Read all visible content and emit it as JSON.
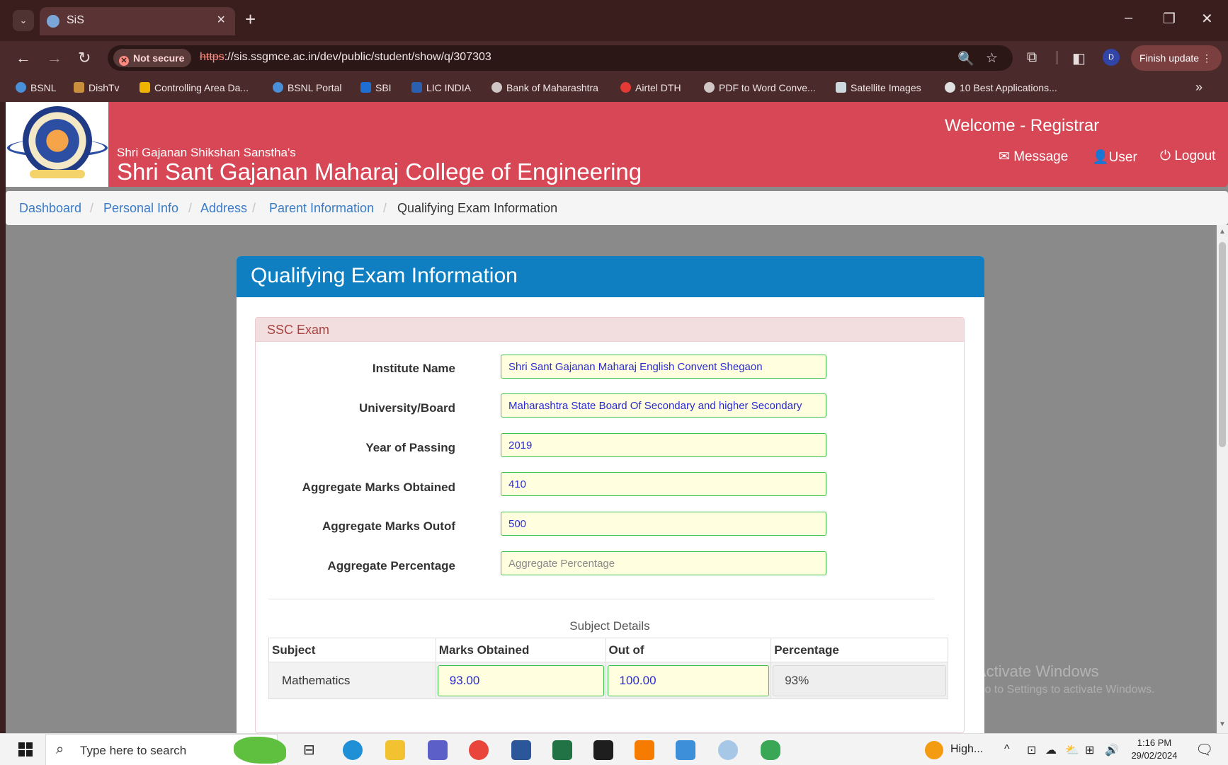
{
  "browser": {
    "tab_title": "SiS",
    "tab_close": "×",
    "new_tab": "+",
    "not_secure": "Not secure",
    "url_proto": "https",
    "url_rest": "://sis.ssgmce.ac.in/dev/public/student/show/q/307303",
    "profile_initial": "D",
    "finish_update": "Finish update ⋮",
    "bookmarks": [
      "BSNL",
      "DishTv",
      "Controlling Area Da...",
      "BSNL Portal",
      "SBI",
      "LIC INDIA",
      "Bank of Maharashtra",
      "Airtel DTH",
      "PDF to Word Conve...",
      "Satellite Images",
      "10 Best Applications..."
    ],
    "bookmarks_more": "»"
  },
  "header": {
    "sanstha": "Shri Gajanan Shikshan Sanstha's",
    "college": "Shri Sant Gajanan Maharaj College of Engineering",
    "welcome": "Welcome - Registrar",
    "links": [
      "Message",
      "User",
      "Logout"
    ]
  },
  "breadcrumb": [
    "Dashboard",
    "Personal Info",
    "Address",
    "Parent Information",
    "Qualifying Exam Information"
  ],
  "card": {
    "title": "Qualifying Exam Information",
    "panel_title": "SSC Exam",
    "fields": [
      {
        "label": "Institute Name",
        "value": "Shri Sant Gajanan Maharaj English Convent Shegaon",
        "placeholder": ""
      },
      {
        "label": "University/Board",
        "value": "Maharashtra State Board Of Secondary and higher Secondary",
        "placeholder": ""
      },
      {
        "label": "Year of Passing",
        "value": "2019",
        "placeholder": ""
      },
      {
        "label": "Aggregate Marks Obtained",
        "value": "410",
        "placeholder": ""
      },
      {
        "label": "Aggregate Marks Outof",
        "value": "500",
        "placeholder": ""
      },
      {
        "label": "Aggregate Percentage",
        "value": "",
        "placeholder": "Aggregate Percentage"
      }
    ],
    "subject_caption": "Subject Details",
    "table": {
      "headers": [
        "Subject",
        "Marks Obtained",
        "Out of",
        "Percentage"
      ],
      "rows": [
        {
          "subject": "Mathematics",
          "marks": "93.00",
          "outof": "100.00",
          "percentage": "93%"
        }
      ]
    }
  },
  "watermark": {
    "line1": "Activate Windows",
    "line2": "Go to Settings to activate Windows."
  },
  "taskbar": {
    "search_placeholder": "Type here to search",
    "weather": "High...",
    "time": "1:16 PM",
    "date": "29/02/2024"
  },
  "colors": {
    "header_red": "#d84756",
    "card_header_blue": "#0f7fc1",
    "panel_danger_bg": "#f2dede",
    "input_bg": "#ffffe0",
    "input_border": "#3cc24a"
  }
}
